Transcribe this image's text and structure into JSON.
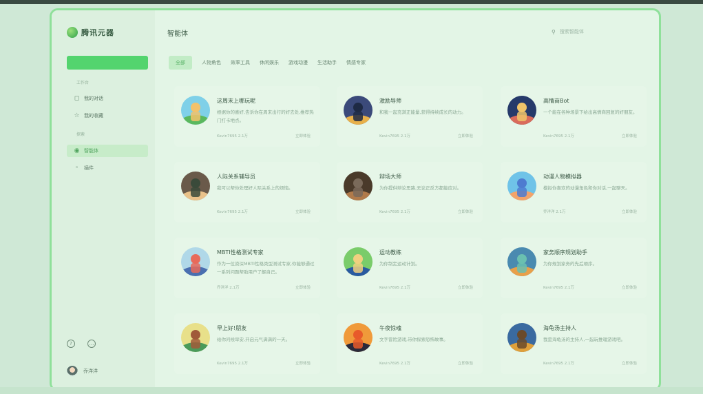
{
  "app": {
    "name": "腾讯元器"
  },
  "sidebar": {
    "new_button": "",
    "section_mine": "工作台",
    "items_mine": [
      {
        "label": "我的对话",
        "icon": "chat-icon"
      },
      {
        "label": "我的收藏",
        "icon": "star-icon"
      }
    ],
    "section_discover": "探索",
    "items_discover": [
      {
        "label": "智能体",
        "icon": "agent-icon",
        "active": true
      },
      {
        "label": "插件",
        "icon": "plugin-icon"
      }
    ],
    "bottom_icons": [
      "help-icon",
      "feedback-icon"
    ],
    "user_name": "乔洋洋"
  },
  "header": {
    "title": "智能体",
    "search_placeholder": "搜索智能体"
  },
  "tabs": [
    {
      "label": "全部",
      "active": true
    },
    {
      "label": "人物角色"
    },
    {
      "label": "效率工具"
    },
    {
      "label": "休闲娱乐"
    },
    {
      "label": "游戏动漫"
    },
    {
      "label": "生活助手"
    },
    {
      "label": "情感专家"
    }
  ],
  "cards": [
    {
      "title": "这周末上哪玩呢",
      "desc": "根据你的喜好,告诉你在周末出行的好去处,推荐热门打卡地点。",
      "meta": "Kevin7695 2.1万",
      "action": "立即体验",
      "img": "park"
    },
    {
      "title": "激励导师",
      "desc": "和我一起充满正能量,获得持续成长的动力。",
      "meta": "Kevin7695 2.1万",
      "action": "立即体验",
      "img": "runner"
    },
    {
      "title": "高情商Bot",
      "desc": "一个能在各种场景下给出高情商回复的好朋友。",
      "meta": "Kevin7695 2.1万",
      "action": "立即体验",
      "img": "city"
    },
    {
      "title": "人际关系辅导员",
      "desc": "我可以帮你处理好人际关系上的烦恼。",
      "meta": "Kevin7695 2.1万",
      "action": "立即体验",
      "img": "couple"
    },
    {
      "title": "辩场大师",
      "desc": "为你提供辩论思路,无论正反方都能应对。",
      "meta": "Kevin7695 2.1万",
      "action": "立即体验",
      "img": "debate"
    },
    {
      "title": "动漫人物模拟器",
      "desc": "模拟你喜欢的动漫角色和你对话,一起聊天。",
      "meta": "乔洋洋 2.1万",
      "action": "立即体验",
      "img": "anime"
    },
    {
      "title": "MBTI性格测试专家",
      "desc": "作为一位资深MBTI性格类型测试专家,你能够通过一系列问题帮助用户了解自己。",
      "meta": "乔洋洋 2.1万",
      "action": "立即体验",
      "img": "mbti"
    },
    {
      "title": "运动教练",
      "desc": "为你制定运动计划。",
      "meta": "Kevin7695 2.1万",
      "action": "立即体验",
      "img": "coach"
    },
    {
      "title": "家务顺序规划助手",
      "desc": "为你规划家务的先后顺序。",
      "meta": "Kevin7695 2.1万",
      "action": "立即体验",
      "img": "house"
    },
    {
      "title": "早上好!朋友",
      "desc": "给你问候早安,开启元气满满的一天。",
      "meta": "Kevin7695 2.1万",
      "action": "立即体验",
      "img": "morning"
    },
    {
      "title": "午夜惊魂",
      "desc": "文字冒险游戏,带你探索恐怖故事。",
      "meta": "Kevin7695 2.1万",
      "action": "立即体验",
      "img": "night"
    },
    {
      "title": "海龟汤主持人",
      "desc": "我是海龟汤的主持人,一起玩推理游戏吧。",
      "meta": "Kevin7695 2.1万",
      "action": "立即体验",
      "img": "turtle"
    }
  ],
  "colors": {
    "accent": "#53d46e",
    "page_bg": "#e3f5e6",
    "frame": "#8fe09a"
  }
}
